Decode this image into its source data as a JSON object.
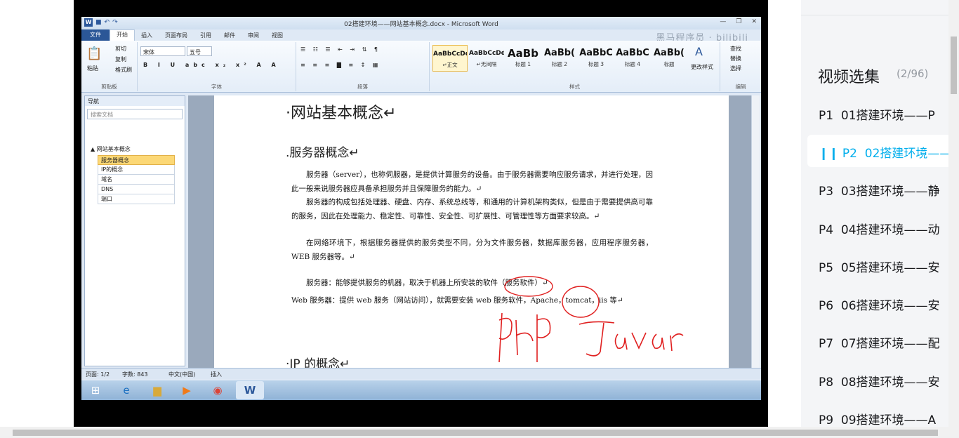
{
  "word": {
    "title": "02搭建环境——网站基本概念.docx - Microsoft Word",
    "tabs": [
      "文件",
      "开始",
      "插入",
      "页面布局",
      "引用",
      "邮件",
      "审阅",
      "视图"
    ],
    "watermark": "黑马程序员 · bilibili",
    "clipboard": {
      "paste": "粘贴",
      "cut": "剪切",
      "copy": "复制",
      "format_painter": "格式刷",
      "label": "剪贴板"
    },
    "font": {
      "name": "宋体",
      "size": "五号",
      "label": "字体"
    },
    "paragraph_label": "段落",
    "styles": [
      {
        "preview": "AaBbCcDd",
        "name": "↵正文",
        "selected": true
      },
      {
        "preview": "AaBbCcDd",
        "name": "↵无间隔",
        "selected": false
      },
      {
        "preview": "AaBb",
        "name": "标题 1",
        "selected": false
      },
      {
        "preview": "AaBb(",
        "name": "标题 2",
        "selected": false
      },
      {
        "preview": "AaBbC",
        "name": "标题 3",
        "selected": false
      },
      {
        "preview": "AaBbC",
        "name": "标题 4",
        "selected": false
      },
      {
        "preview": "AaBb(",
        "name": "标题",
        "selected": false
      }
    ],
    "styles_label": "样式",
    "change_styles": "更改样式",
    "editing": {
      "find": "查找",
      "replace": "替换",
      "select": "选择",
      "label": "编辑"
    },
    "nav": {
      "header": "导航",
      "search_placeholder": "搜索文档",
      "root": "网站基本概念",
      "items": [
        {
          "label": "服务器概念",
          "selected": true
        },
        {
          "label": "IP的概念",
          "selected": false
        },
        {
          "label": "域名",
          "selected": false
        },
        {
          "label": "DNS",
          "selected": false
        },
        {
          "label": "端口",
          "selected": false
        }
      ]
    },
    "doc": {
      "h1": "·网站基本概念↵",
      "h2": ".服务器概念↵",
      "p1": "服务器（server），也称伺服器，是提供计算服务的设备。由于服务器需要响应服务请求，并进行处理，因此一般来说服务器应具备承担服务并且保障服务的能力。↵",
      "p2": "服务器的构成包括处理器、硬盘、内存、系统总线等，和通用的计算机架构类似，但是由于需要提供高可靠的服务，因此在处理能力、稳定性、可靠性、安全性、可扩展性、可管理性等方面要求较高。↵",
      "p3": "在网络环境下，根据服务器提供的服务类型不同，分为文件服务器，数据库服务器，应用程序服务器，WEB 服务器等。↵",
      "p4": "服务器：能够提供服务的机器，取决于机器上所安装的软件（服务软件）↵",
      "p5": "Web 服务器：提供 web 服务（网站访问），就需要安装 web 服务软件，Apache，tomcat，iis 等↵",
      "h3": "·IP 的概念↵",
      "handwriting": "PHP Java"
    },
    "status": {
      "page": "页面: 1/2",
      "words": "字数: 843",
      "lang": "中文(中国)",
      "mode": "插入"
    }
  },
  "sidebar": {
    "title": "视频选集",
    "count": "(2/96)",
    "episodes": [
      {
        "num": "P1",
        "title": "01搭建环境——P",
        "active": false
      },
      {
        "num": "P2",
        "title": "02搭建环境——",
        "active": true
      },
      {
        "num": "P3",
        "title": "03搭建环境——静",
        "active": false
      },
      {
        "num": "P4",
        "title": "04搭建环境——动",
        "active": false
      },
      {
        "num": "P5",
        "title": "05搭建环境——安",
        "active": false
      },
      {
        "num": "P6",
        "title": "06搭建环境——安",
        "active": false
      },
      {
        "num": "P7",
        "title": "07搭建环境——配",
        "active": false
      },
      {
        "num": "P8",
        "title": "08搭建环境——安",
        "active": false
      },
      {
        "num": "P9",
        "title": "09搭建环境——A",
        "active": false
      }
    ]
  }
}
